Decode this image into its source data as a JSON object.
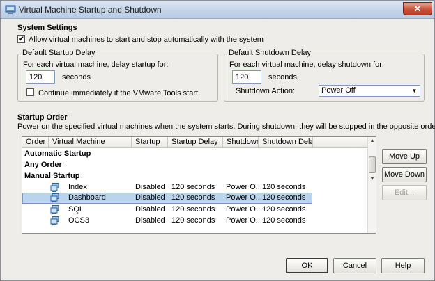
{
  "window": {
    "title": "Virtual Machine Startup and Shutdown",
    "close_label": "✕"
  },
  "system_settings": {
    "title": "System Settings",
    "allow_checkbox": {
      "label": "Allow virtual machines to start and stop automatically with the system",
      "checked": true,
      "mark": "✔"
    }
  },
  "startup_delay": {
    "title": "Default Startup Delay",
    "prompt": "For each virtual machine, delay startup for:",
    "value": "120",
    "unit": "seconds",
    "continue_checkbox": {
      "label": "Continue immediately if the VMware Tools start",
      "checked": false
    }
  },
  "shutdown_delay": {
    "title": "Default Shutdown Delay",
    "prompt": "For each virtual machine, delay shutdown for:",
    "value": "120",
    "unit": "seconds",
    "action_label": "Shutdown Action:",
    "action_value": "Power Off"
  },
  "startup_order": {
    "title": "Startup Order",
    "description": "Power on the specified virtual machines when the system starts. During shutdown, they will be stopped in the opposite order.",
    "columns": [
      "Order",
      "Virtual Machine",
      "Startup",
      "Startup Delay",
      "Shutdown",
      "Shutdown Delay"
    ],
    "groups": [
      "Automatic Startup",
      "Any Order",
      "Manual Startup"
    ],
    "rows": [
      {
        "name": "Index",
        "startup": "Disabled",
        "startup_delay": "120 seconds",
        "shutdown": "Power O...",
        "shutdown_delay": "120 seconds",
        "selected": false
      },
      {
        "name": "Dashboard",
        "startup": "Disabled",
        "startup_delay": "120 seconds",
        "shutdown": "Power O...",
        "shutdown_delay": "120 seconds",
        "selected": true
      },
      {
        "name": "SQL",
        "startup": "Disabled",
        "startup_delay": "120 seconds",
        "shutdown": "Power O...",
        "shutdown_delay": "120 seconds",
        "selected": false
      },
      {
        "name": "OCS3",
        "startup": "Disabled",
        "startup_delay": "120 seconds",
        "shutdown": "Power O...",
        "shutdown_delay": "120 seconds",
        "selected": false
      }
    ]
  },
  "side_buttons": {
    "move_up": "Move Up",
    "move_down": "Move Down",
    "edit": "Edit..."
  },
  "footer": {
    "ok": "OK",
    "cancel": "Cancel",
    "help": "Help"
  }
}
